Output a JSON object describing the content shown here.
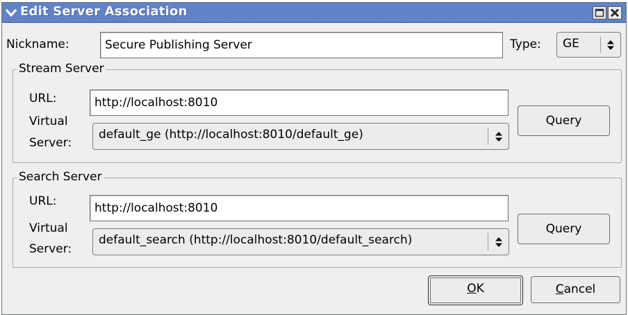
{
  "window": {
    "title": "Edit Server Association",
    "menu_icon": "chevron-down-icon",
    "maximize_icon": "maximize-icon",
    "close_icon": "close-icon",
    "titlebar_color": "#5d7fc6"
  },
  "nickname": {
    "label": "Nickname:",
    "value": "Secure Publishing Server"
  },
  "type": {
    "label": "Type:",
    "value": "GE"
  },
  "stream_server": {
    "title": "Stream Server",
    "url_label": "URL:",
    "url_value": "http://localhost:8010",
    "virtual_label_1": "Virtual",
    "virtual_label_2": "Server:",
    "virtual_value": "default_ge (http://localhost:8010/default_ge)",
    "query_label": "Query"
  },
  "search_server": {
    "title": "Search Server",
    "url_label": "URL:",
    "url_value": "http://localhost:8010",
    "virtual_label_1": "Virtual",
    "virtual_label_2": "Server:",
    "virtual_value": "default_search (http://localhost:8010/default_search)",
    "query_label": "Query"
  },
  "buttons": {
    "ok_mnemonic": "O",
    "ok_rest": "K",
    "cancel_mnemonic": "C",
    "cancel_rest": "ancel"
  }
}
